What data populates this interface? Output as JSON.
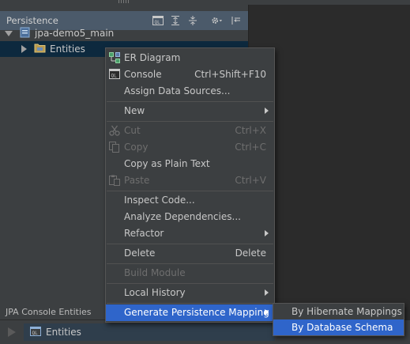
{
  "persistence_panel": {
    "title": "Persistence",
    "toolbar_icons": [
      "console-icon",
      "expand-all-icon",
      "collapse-all-icon",
      "settings-icon",
      "hide-icon"
    ],
    "tree": [
      {
        "label": "jpa-demo5_main",
        "icon": "module-icon",
        "expanded": true
      },
      {
        "label": "Entities",
        "icon": "entities-folder-icon",
        "expanded": false,
        "selected": true
      }
    ]
  },
  "context_menu": {
    "items": [
      {
        "label": "ER Diagram",
        "icon": "er-diagram-icon"
      },
      {
        "label": "Console",
        "icon": "console-icon",
        "shortcut": "Ctrl+Shift+F10"
      },
      {
        "label": "Assign Data Sources..."
      },
      {
        "label": "New",
        "has_submenu": true
      },
      {
        "label": "Cut",
        "icon": "cut-icon",
        "shortcut": "Ctrl+X",
        "disabled": true
      },
      {
        "label": "Copy",
        "icon": "copy-icon",
        "shortcut": "Ctrl+C",
        "disabled": true
      },
      {
        "label": "Copy as Plain Text"
      },
      {
        "label": "Paste",
        "icon": "paste-icon",
        "shortcut": "Ctrl+V",
        "disabled": true
      },
      {
        "label": "Inspect Code..."
      },
      {
        "label": "Analyze Dependencies..."
      },
      {
        "label": "Refactor",
        "has_submenu": true
      },
      {
        "label": "Delete",
        "shortcut": "Delete"
      },
      {
        "label": "Build Module",
        "disabled": true
      },
      {
        "label": "Local History",
        "has_submenu": true
      },
      {
        "label": "Generate Persistence Mapping",
        "has_submenu": true,
        "highlighted": true
      }
    ]
  },
  "submenu": {
    "items": [
      {
        "label": "By Hibernate Mappings"
      },
      {
        "label": "By Database Schema",
        "highlighted": true
      }
    ]
  },
  "bottom_panel": {
    "title": "JPA Console Entities",
    "entry": "Entities"
  },
  "colors": {
    "background": "#2b2b2b",
    "panel": "#3c3f41",
    "header": "#4b5a6a",
    "selection": "#0d293e",
    "highlight": "#2f65ca"
  }
}
